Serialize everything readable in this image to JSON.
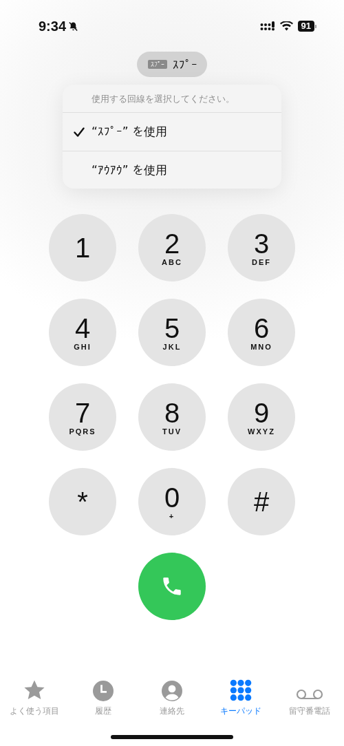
{
  "status_bar": {
    "time": "9:34",
    "battery": "91"
  },
  "line_selector": {
    "badge": "ｽﾌﾟｰ",
    "label": "ｽﾌﾟｰ"
  },
  "line_menu": {
    "prompt": "使用する回線を選択してください。",
    "options": [
      {
        "label": "“ｽﾌﾟｰ” を使用",
        "selected": true
      },
      {
        "label": "“ｱｳｱｳ” を使用",
        "selected": false
      }
    ]
  },
  "keypad": [
    {
      "digit": "1"
    },
    {
      "digit": "2",
      "letters": "ABC"
    },
    {
      "digit": "3",
      "letters": "DEF"
    },
    {
      "digit": "4",
      "letters": "GHI"
    },
    {
      "digit": "5",
      "letters": "JKL"
    },
    {
      "digit": "6",
      "letters": "MNO"
    },
    {
      "digit": "7",
      "letters": "PQRS"
    },
    {
      "digit": "8",
      "letters": "TUV"
    },
    {
      "digit": "9",
      "letters": "WXYZ"
    },
    {
      "digit": "*"
    },
    {
      "digit": "0",
      "letters": "+"
    },
    {
      "digit": "#"
    }
  ],
  "tabs": [
    {
      "label": "よく使う項目",
      "kind": "favorites",
      "selected": false
    },
    {
      "label": "履歴",
      "kind": "recents",
      "selected": false
    },
    {
      "label": "連絡先",
      "kind": "contacts",
      "selected": false
    },
    {
      "label": "キーパッド",
      "kind": "keypad",
      "selected": true
    },
    {
      "label": "留守番電話",
      "kind": "voicemail",
      "selected": false
    }
  ]
}
